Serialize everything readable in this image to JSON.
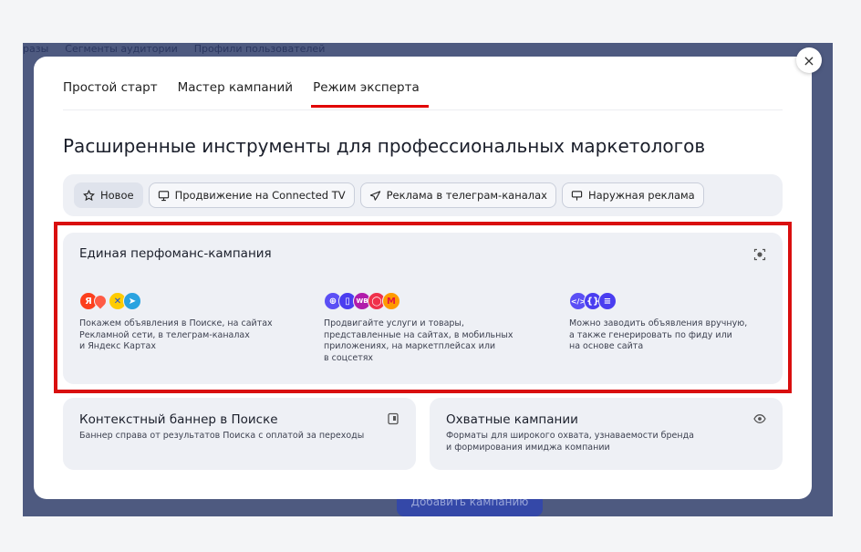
{
  "background": {
    "nav_items": [
      "разы",
      "Сегменты аудитории",
      "Профили пользователей"
    ],
    "add_campaign_button": "Добавить кампанию"
  },
  "modal": {
    "close_label": "×",
    "tabs": [
      {
        "label": "Простой старт",
        "active": false
      },
      {
        "label": "Мастер кампаний",
        "active": false
      },
      {
        "label": "Режим эксперта",
        "active": true
      }
    ],
    "heading": "Расширенные инструменты для профессиональных маркетологов",
    "filters": [
      {
        "label": "Новое",
        "icon": "star-icon",
        "active": true
      },
      {
        "label": "Продвижение на Connected TV",
        "icon": "tv-icon",
        "active": false
      },
      {
        "label": "Реклама в телеграм-каналах",
        "icon": "send-icon",
        "active": false
      },
      {
        "label": "Наружная реклама",
        "icon": "billboard-icon",
        "active": false
      }
    ],
    "performance_card": {
      "title": "Единая перфоманс-кампания",
      "columns": [
        {
          "icons": [
            "yandex-icon",
            "maps-pin-icon",
            "network-icon",
            "telegram-icon"
          ],
          "lines": [
            "Покажем объявления в Поиске, на сайтах",
            "Рекламной сети, в телеграм-каналах",
            "и Яндекс Картах"
          ]
        },
        {
          "icons": [
            "globe-icon",
            "mobile-app-icon",
            "wildberries-icon",
            "ozon-icon",
            "market-icon"
          ],
          "lines": [
            "Продвигайте услуги и товары,",
            "представленные на сайтах, в мобильных",
            "приложениях, на маркетплейсах или",
            "в соцсетях"
          ]
        },
        {
          "icons": [
            "code-icon",
            "feed-icon",
            "list-icon"
          ],
          "lines": [
            "Можно заводить объявления вручную,",
            "а также генерировать по фиду или",
            "на основе сайта"
          ]
        }
      ]
    },
    "context_banner_card": {
      "title": "Контекстный баннер в Поиске",
      "lines": [
        "Баннер справа от результатов Поиска с оплатой за переходы"
      ]
    },
    "reach_card": {
      "title": "Охватные кампании",
      "lines": [
        "Форматы для широкого охвата, узнаваемости бренда",
        "и формирования имиджа компании"
      ]
    }
  },
  "colors": {
    "accent_red": "#e10000",
    "highlight_frame": "#d90f0f",
    "card_bg": "#eef0f5",
    "backdrop": "#4e5a80"
  }
}
